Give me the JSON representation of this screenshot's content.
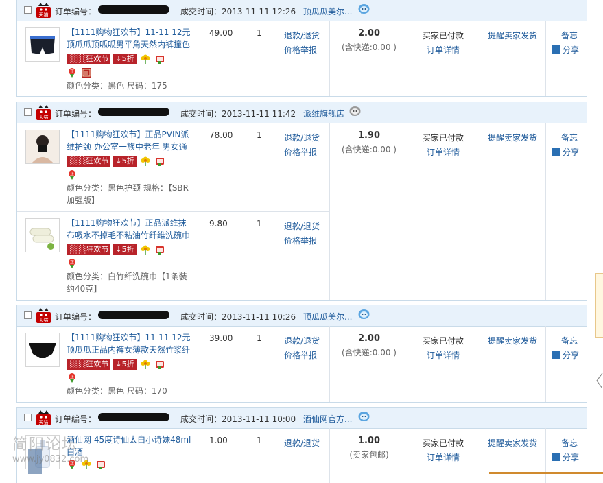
{
  "labels": {
    "order_no": "订单编号：",
    "deal_time": "成交时间：",
    "sale_tag": "狂欢节",
    "discount_tag": "↓5折",
    "refund": "退款/退货",
    "price_report": "价格举报",
    "order_detail": "订单详情",
    "remind_ship": "提醒卖家发货",
    "memo": "备忘",
    "share": "分享"
  },
  "icons": {
    "tmall": "tmall-cat-icon",
    "wangwang": "wangwang-chat-icon",
    "ticket": "ticket-icon",
    "flower": "flower-icon",
    "badge": "zheng-badge-icon",
    "share": "share-arrow-icon"
  },
  "colors": {
    "link": "#225d9c",
    "header_bg": "#e8f2fb",
    "border": "#c9dbe9",
    "tag_red": "#b8232a"
  },
  "orders": [
    {
      "time": "2013-11-11 12:26",
      "shop": "顶瓜瓜美尔...",
      "items": [
        {
          "title": "【1111购物狂欢节】11-11 12元顶瓜瓜顶呱呱男平角天然内裤撞色",
          "price": "49.00",
          "qty": "1",
          "sku": "颜色分类：黑色 尺码：175"
        }
      ],
      "total": "2.00",
      "shipping": "(含快递:0.00 )",
      "status": "买家已付款"
    },
    {
      "time": "2013-11-11 11:42",
      "shop": "派维旗舰店",
      "items": [
        {
          "title": "【1111购物狂欢节】正品PVIN派维护颈 办公室一族中老年 男女通",
          "price": "78.00",
          "qty": "1",
          "sku": "颜色分类：黑色护颈 规格：【SBR加强版】"
        },
        {
          "title": "【1111购物狂欢节】正品派维抹布吸水不掉毛不粘油竹纤维洗碗巾",
          "price": "9.80",
          "qty": "1",
          "sku": "颜色分类：白竹纤洗碗巾【1条装约40克】"
        }
      ],
      "total": "1.90",
      "shipping": "(含快递:0.00 )",
      "status": "买家已付款"
    },
    {
      "time": "2013-11-11 10:26",
      "shop": "顶瓜瓜美尔...",
      "items": [
        {
          "title": "【1111购物狂欢节】11-11 12元顶瓜瓜正品内裤女薄款天然竹浆纤",
          "price": "39.00",
          "qty": "1",
          "sku": "颜色分类：黑色 尺码：170"
        }
      ],
      "total": "2.00",
      "shipping": "(含快递:0.00 )",
      "status": "买家已付款"
    },
    {
      "time": "2013-11-11 10:00",
      "shop": "酒仙网官方...",
      "items": [
        {
          "title": "酒仙网 45度诗仙太白小诗妹48ml 白酒",
          "price": "1.00",
          "qty": "1",
          "sku": ""
        }
      ],
      "total": "1.00",
      "shipping": "(卖家包邮)",
      "status": "买家已付款"
    }
  ],
  "watermark": {
    "line1": "简阳论坛",
    "line2": "www.jy0832.com"
  }
}
